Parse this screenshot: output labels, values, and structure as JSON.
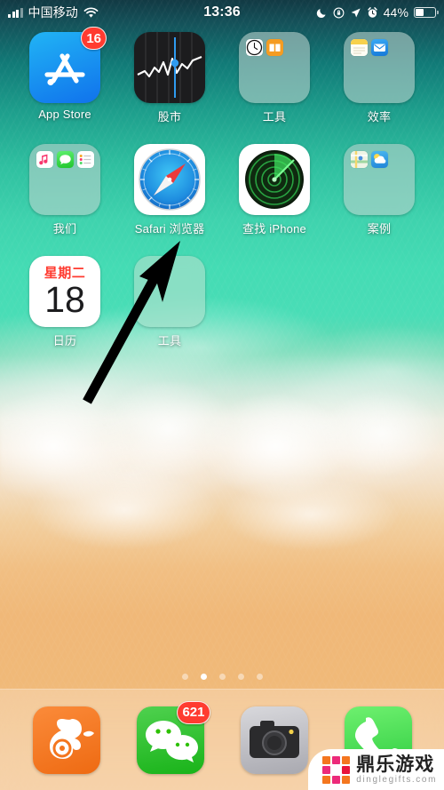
{
  "status_bar": {
    "carrier": "中国移动",
    "signal_icon": "signal-bars-icon",
    "wifi_icon": "wifi-icon",
    "time": "13:36",
    "dnd_icon": "moon-do-not-disturb-icon",
    "rotation_lock_icon": "rotation-lock-icon",
    "location_icon": "location-arrow-icon",
    "alarm_icon": "alarm-clock-icon",
    "battery_percent": "44%",
    "battery_level": 44
  },
  "home_screen": {
    "rows": [
      [
        {
          "name": "App Store",
          "type": "app",
          "icon": "app-store-icon",
          "badge": "16"
        },
        {
          "name": "股市",
          "type": "app",
          "icon": "stocks-icon",
          "badge": null
        },
        {
          "name": "工具",
          "type": "folder",
          "icon": "folder-icon",
          "badge": null,
          "contents": [
            "clock-icon",
            "translate-icon"
          ]
        },
        {
          "name": "效率",
          "type": "folder",
          "icon": "folder-icon",
          "badge": null,
          "contents": [
            "notes-icon",
            "mail-icon"
          ]
        }
      ],
      [
        {
          "name": "我们",
          "type": "folder",
          "icon": "folder-icon",
          "badge": null,
          "contents": [
            "music-icon",
            "messages-icon",
            "reminders-icon"
          ]
        },
        {
          "name": "Safari 浏览器",
          "type": "app",
          "icon": "safari-compass-icon",
          "badge": null
        },
        {
          "name": "查找 iPhone",
          "type": "app",
          "icon": "find-my-iphone-radar-icon",
          "badge": null
        },
        {
          "name": "案例",
          "type": "folder",
          "icon": "folder-icon",
          "badge": null,
          "contents": [
            "maps-icon",
            "weather-icon"
          ]
        }
      ],
      [
        {
          "name": "日历",
          "type": "app",
          "icon": "calendar-icon",
          "badge": null,
          "weekday": "星期二",
          "day": "18"
        },
        {
          "name": "工具",
          "type": "folder",
          "icon": "folder-icon",
          "badge": null,
          "contents": []
        }
      ]
    ]
  },
  "page_dots": {
    "count": 5,
    "active_index": 1
  },
  "dock": {
    "items": [
      {
        "name": "UC浏览器",
        "icon": "uc-browser-squirrel-icon",
        "badge": null
      },
      {
        "name": "微信",
        "icon": "wechat-icon",
        "badge": "621"
      },
      {
        "name": "相机",
        "icon": "camera-icon",
        "badge": null
      },
      {
        "name": "电话",
        "icon": "phone-icon",
        "badge": null
      }
    ]
  },
  "annotation": {
    "arrow_icon": "black-arrow-pointing-up-right",
    "points_to": "Safari 浏览器"
  },
  "watermark": {
    "logo_icon": "pixel-grid-logo-icon",
    "title": "鼎乐游戏",
    "url": "dinglegifts.com"
  },
  "colors": {
    "badge_red": "#ff3b30",
    "wechat_green": "#2dc100",
    "uc_orange": "#f4761f",
    "phone_green": "#4cd964",
    "calendar_red": "#ff3b30",
    "appstore_blue": "#1072ec",
    "water_teal": "#44dcb4",
    "sand": "#f0b878"
  }
}
